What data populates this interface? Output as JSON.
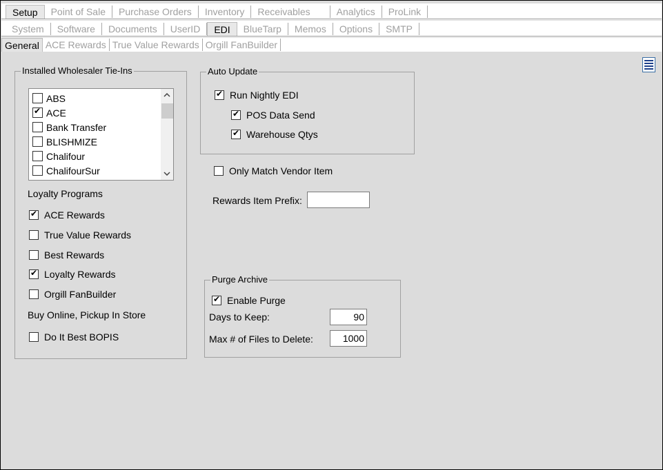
{
  "top_tabs": [
    {
      "label": "Setup",
      "active": true
    },
    {
      "label": "Point of Sale"
    },
    {
      "label": "Purchase Orders"
    },
    {
      "label": "Inventory"
    },
    {
      "label": "Receivables"
    },
    {
      "label": "Analytics"
    },
    {
      "label": "ProLink"
    }
  ],
  "setup_tabs": [
    {
      "label": "System"
    },
    {
      "label": "Software"
    },
    {
      "label": "Documents"
    },
    {
      "label": "UserID"
    },
    {
      "label": "EDI",
      "active": true
    },
    {
      "label": "BlueTarp"
    },
    {
      "label": "Memos"
    },
    {
      "label": "Options"
    },
    {
      "label": "SMTP"
    }
  ],
  "edi_tabs": [
    {
      "label": "General",
      "active": true
    },
    {
      "label": "ACE Rewards"
    },
    {
      "label": "True Value Rewards"
    },
    {
      "label": "Orgill FanBuilder"
    }
  ],
  "wholesaler": {
    "title": "Installed Wholesaler Tie-Ins",
    "items": [
      {
        "label": "ABS",
        "checked": false
      },
      {
        "label": "ACE",
        "checked": true
      },
      {
        "label": "Bank Transfer",
        "checked": false
      },
      {
        "label": "BLISHMIZE",
        "checked": false
      },
      {
        "label": "Chalifour",
        "checked": false
      },
      {
        "label": "ChalifourSur",
        "checked": false
      }
    ],
    "loyalty_label": "Loyalty Programs",
    "loyalty": [
      {
        "label": "ACE Rewards",
        "checked": true
      },
      {
        "label": "True Value Rewards",
        "checked": false
      },
      {
        "label": "Best Rewards",
        "checked": false
      },
      {
        "label": "Loyalty Rewards",
        "checked": true
      },
      {
        "label": "Orgill FanBuilder",
        "checked": false
      }
    ],
    "bopis_label": "Buy Online, Pickup In Store",
    "bopis": [
      {
        "label": "Do It Best BOPIS",
        "checked": false
      }
    ]
  },
  "auto_update": {
    "title": "Auto Update",
    "run_nightly": {
      "label": "Run Nightly EDI",
      "checked": true
    },
    "pos_send": {
      "label": "POS Data Send",
      "checked": true
    },
    "warehouse": {
      "label": "Warehouse Qtys",
      "checked": true
    }
  },
  "only_match": {
    "label": "Only Match Vendor Item",
    "checked": false
  },
  "rewards_prefix": {
    "label": "Rewards Item Prefix:",
    "value": ""
  },
  "purge": {
    "title": "Purge Archive",
    "enable": {
      "label": "Enable Purge",
      "checked": true
    },
    "days_label": "Days to Keep:",
    "days_value": "90",
    "max_label": "Max # of Files to Delete:",
    "max_value": "1000"
  },
  "icons": {
    "menu": "hamburger-menu-icon",
    "scroll_up": "chevron-up-icon",
    "scroll_down": "chevron-down-icon"
  }
}
